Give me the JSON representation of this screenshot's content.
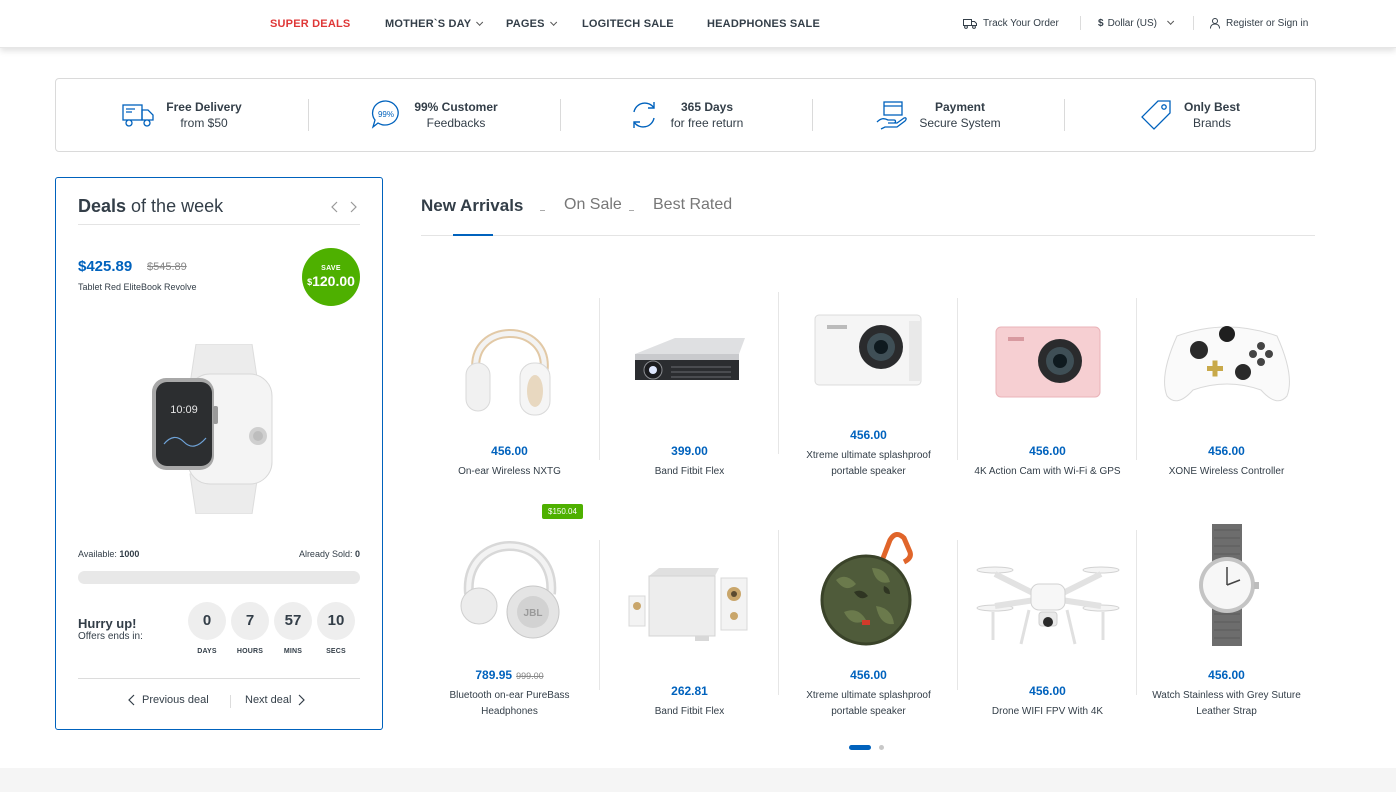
{
  "nav": {
    "items": [
      {
        "label": "SUPER DEALS"
      },
      {
        "label": "MOTHER`S DAY"
      },
      {
        "label": "PAGES"
      },
      {
        "label": "LOGITECH SALE"
      },
      {
        "label": "HEADPHONES SALE"
      }
    ],
    "track_order": "Track Your Order",
    "currency_symbol": "$",
    "currency": "Dollar (US)",
    "account": "Register or Sign in"
  },
  "features": [
    {
      "title": "Free Delivery",
      "subtitle": "from $50",
      "icon": "delivery-truck-icon"
    },
    {
      "title": "99% Customer",
      "subtitle": "Feedbacks",
      "icon": "feedback-bubble-icon",
      "icon_text": "99%"
    },
    {
      "title": "365 Days",
      "subtitle": "for free return",
      "icon": "return-arrows-icon"
    },
    {
      "title": "Payment",
      "subtitle": "Secure System",
      "icon": "secure-payment-icon"
    },
    {
      "title": "Only Best",
      "subtitle": "Brands",
      "icon": "price-tag-icon"
    }
  ],
  "deals": {
    "title_bold": "Deals",
    "title_rest": " of the week",
    "price": "$425.89",
    "old_price": "$545.89",
    "product_name": "Tablet Red EliteBook Revolve",
    "save_label": "SAVE",
    "save_currency": "$",
    "save_amount": "120.00",
    "available_label": "Available:",
    "available_value": "1000",
    "sold_label": "Already Sold:",
    "sold_value": "0",
    "sold_fraction": 0,
    "hurry": "Hurry up!",
    "ends": "Offers ends in:",
    "countdown": [
      {
        "value": "0",
        "label": "DAYS"
      },
      {
        "value": "7",
        "label": "HOURS"
      },
      {
        "value": "57",
        "label": "MINS"
      },
      {
        "value": "10",
        "label": "SECS"
      }
    ],
    "watch_time": "10:09",
    "prev_label": "Previous deal",
    "next_label": "Next deal"
  },
  "tabs": [
    {
      "label": "New Arrivals",
      "active": true
    },
    {
      "label": "On Sale",
      "active": false
    },
    {
      "label": "Best Rated",
      "active": false
    }
  ],
  "products_row1": [
    {
      "price": "456.00",
      "name": "On-ear Wireless NXTG",
      "image": "headphones-white"
    },
    {
      "price": "399.00",
      "name": "Band Fitbit Flex",
      "image": "projector"
    },
    {
      "price": "456.00",
      "name": "Xtreme ultimate splashproof portable speaker",
      "image": "action-camera-white"
    },
    {
      "price": "456.00",
      "name": "4K Action Cam with Wi-Fi & GPS",
      "image": "action-camera-pink"
    },
    {
      "price": "456.00",
      "name": "XONE Wireless Controller",
      "image": "game-controller"
    }
  ],
  "products_row2": [
    {
      "price": "789.95",
      "old_price": "999.00",
      "name": "Bluetooth on-ear PureBass Headphones",
      "image": "headphones-silver",
      "badge": "$150.04"
    },
    {
      "price": "262.81",
      "name": "Band Fitbit Flex",
      "image": "speaker-system"
    },
    {
      "price": "456.00",
      "name": "Xtreme ultimate splashproof portable speaker",
      "image": "camo-speaker"
    },
    {
      "price": "456.00",
      "name": "Drone WIFI FPV With 4K",
      "image": "drone"
    },
    {
      "price": "456.00",
      "name": "Watch Stainless with Grey Suture Leather Strap",
      "image": "wristwatch"
    }
  ],
  "colors": {
    "accent": "#0062bd",
    "red": "#df3737",
    "green": "#4eb000",
    "text": "#333e48"
  }
}
